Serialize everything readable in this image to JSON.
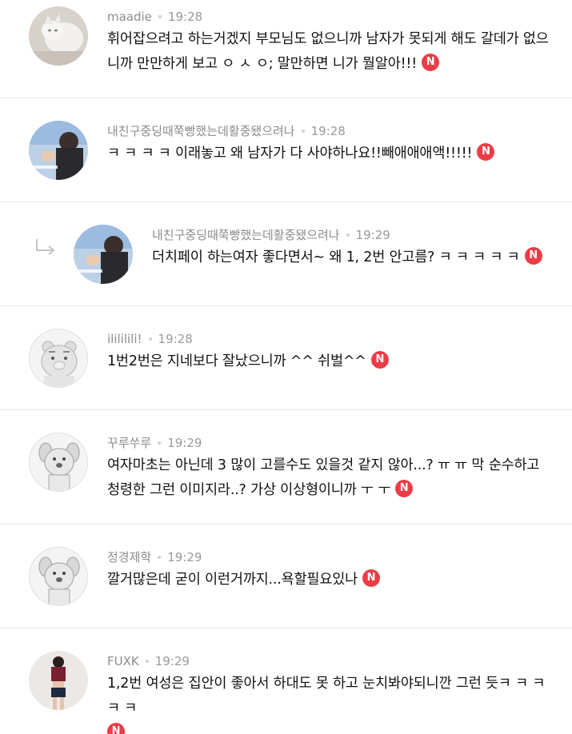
{
  "comments": [
    {
      "username": "maadie",
      "time": "19:28",
      "text": "휘어잡으려고 하는거겠지 부모님도 없으니까 남자가 못되게 해도 갈데가 없으니까 만만하게 보고 ㅇ ㅅ ㅇ; 말만하면 니가 뭘알아!!!",
      "badge": "N",
      "avatar_icon": "cat-photo-avatar"
    },
    {
      "username": "내친구중딩때쭉빵했는데활중됐으려나",
      "time": "19:28",
      "text": "ㅋ ㅋ ㅋ ㅋ 이래놓고 왜 남자가 다 사야하나요!!빼애애애액!!!!!",
      "badge": "N",
      "avatar_icon": "person-photo-avatar"
    },
    {
      "username": "내친구중딩때쭉빵했는데활중됐으려나",
      "time": "19:29",
      "text": "더치페이 하는여자 좋다면서~ 왜 1, 2번 안고름? ㅋ ㅋ ㅋ ㅋ ㅋ",
      "badge": "N",
      "avatar_icon": "person-photo-avatar",
      "is_reply": true
    },
    {
      "username": "ilililili!",
      "time": "19:28",
      "text": "1번2번은 지네보다 잘났으니까 ^^ 쉬벌^^",
      "badge": "N",
      "avatar_icon": "bear-character-avatar"
    },
    {
      "username": "꾸루쑤루",
      "time": "19:29",
      "text": "여자마초는 아닌데 3 많이 고를수도 있을것 같지 않아...? ㅠ ㅠ 막 순수하고 청령한 그런 이미지라..? 가상 이상형이니까 ㅜ ㅜ",
      "badge": "N",
      "avatar_icon": "dog-character-avatar"
    },
    {
      "username": "정경제학",
      "time": "19:29",
      "text": "깔거많은데 굳이 이런거까지...욕할필요있나",
      "badge": "N",
      "avatar_icon": "dog-character-avatar"
    },
    {
      "username": "FUXK",
      "time": "19:29",
      "text": "1,2번 여성은 집안이 좋아서 하대도 못 하고 눈치봐야되니깐 그런 듯ㅋ ㅋ ㅋ ㅋ ㅋ",
      "badge": "N",
      "avatar_icon": "woman-photo-avatar"
    }
  ],
  "colors": {
    "badge": "#ec3c46",
    "meta": "#999999",
    "divider": "#e6e6e6",
    "text": "#111111"
  }
}
